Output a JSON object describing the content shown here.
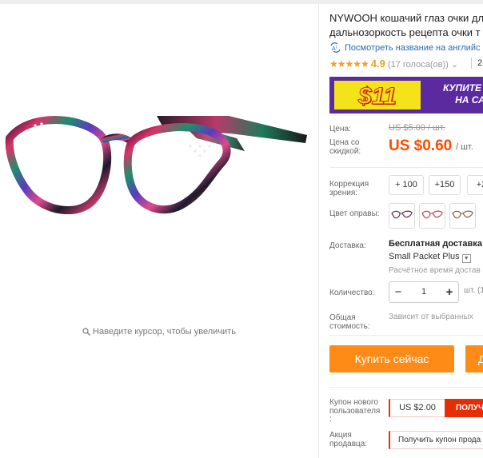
{
  "product": {
    "title_line1": "NYWOOH кошачий глаз очки дл",
    "title_line2": "дальнозоркость рецепта очки т",
    "translate_link": "Посмотреть название на английс",
    "rating_stars": "★★★★★",
    "rating_value": "4.9",
    "votes": "(17 голоса(ов))",
    "votes_caret": "⌄",
    "orders_cut": "2"
  },
  "gallery": {
    "zoom_hint": "Наведите курсор, чтобы увеличить"
  },
  "promo": {
    "price": "$11",
    "text_line1": "КУПИТЕ СЕ",
    "text_line2": "НА СА"
  },
  "price": {
    "label": "Цена:",
    "original": "US $5.00 / шт.",
    "sale_label_1": "Цена со",
    "sale_label_2": "скидкой:",
    "sale": "US $0.60",
    "unit": "/ шт."
  },
  "options": {
    "correction_label_1": "Коррекция",
    "correction_label_2": "зрения:",
    "corrections": [
      "+ 100",
      "+150",
      "+2"
    ],
    "frame_color_label": "Цвет оправы:"
  },
  "shipping": {
    "label": "Доставка:",
    "title": "Бесплатная доставка в",
    "method": "Small Packet Plus",
    "time": "Расчётное время достав"
  },
  "quantity": {
    "label": "Количество:",
    "minus": "−",
    "value": "1",
    "plus": "+",
    "unit": "шт. (1"
  },
  "total": {
    "label_1": "Общая",
    "label_2": "стоимость:",
    "value": "Зависит от выбранных"
  },
  "actions": {
    "buy_now": "Купить сейчас",
    "cart_cut": "Д"
  },
  "coupon": {
    "label_1": "Купон нового",
    "label_2": "пользователя",
    "label_3": ":",
    "amount": "US $2.00",
    "get": "ПОЛУЧ"
  },
  "seller": {
    "label_1": "Акция",
    "label_2": "продавца:",
    "button": "Получить купон прода"
  },
  "colors": {
    "accent": "#ff4a00",
    "buy_button": "#ff8b17",
    "coupon_red": "#e62e04",
    "link_blue": "#2a6ab0",
    "star": "#f59d1c",
    "promo_purple": "#5a2a9e",
    "promo_yellow": "#f4e21b"
  }
}
